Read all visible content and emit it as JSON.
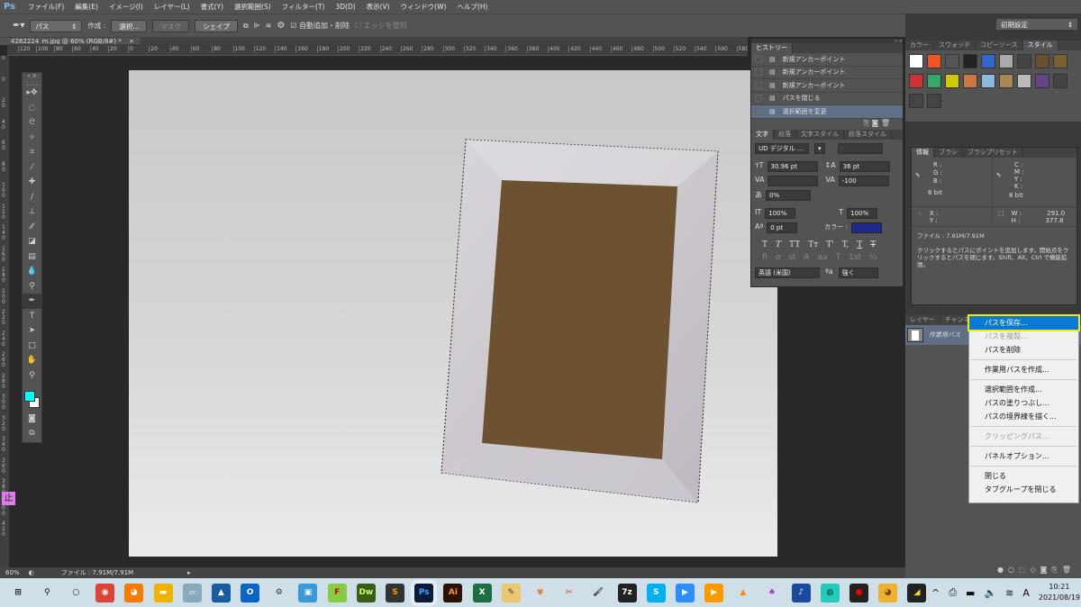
{
  "app": {
    "logo": "Ps",
    "menu": [
      "ファイル(F)",
      "編集(E)",
      "イメージ(I)",
      "レイヤー(L)",
      "書式(Y)",
      "選択範囲(S)",
      "フィルター(T)",
      "3D(D)",
      "表示(V)",
      "ウィンドウ(W)",
      "ヘルプ(H)"
    ]
  },
  "options": {
    "mode": "パス",
    "create_label": "作成 :",
    "select_btn": "選択...",
    "mask_btn": "マスク",
    "shape_btn": "シェイプ",
    "auto_add_label": "自動追加・削除",
    "auto_add_checked": true,
    "align_edges_label": "エッジを整列",
    "align_edges_checked": false,
    "workspace": "初期設定"
  },
  "document": {
    "tab": "4282224_m.jpg @ 60% (RGB/8#) *",
    "close": "×"
  },
  "rulers": {
    "h": [
      "120",
      "100",
      "80",
      "60",
      "40",
      "20",
      "0",
      "20",
      "40",
      "60",
      "80",
      "100",
      "120",
      "140",
      "160",
      "180",
      "200",
      "220",
      "240",
      "260",
      "280",
      "300",
      "320",
      "340",
      "360",
      "380",
      "400",
      "420",
      "440",
      "460",
      "480",
      "500",
      "520",
      "540",
      "560",
      "580",
      "600",
      "620",
      "64"
    ],
    "v": [
      "0",
      "0",
      "2 0",
      "4 0",
      "6 0",
      "8 0",
      "1 0 0",
      "1 2 0",
      "1 4 0",
      "1 6 0",
      "1 8 0",
      "2 0 0",
      "2 2 0",
      "2 4 0",
      "2 6 0",
      "2 8 0",
      "3 0 0",
      "3 2 0",
      "3 4 0",
      "3 6 0",
      "3 8 0",
      "4 0 0",
      "4 2 0"
    ]
  },
  "tools": [
    "move-tool",
    "marquee-tool",
    "lasso-tool",
    "magic-wand-tool",
    "crop-tool",
    "eyedropper-tool",
    "healing-brush-tool",
    "brush-tool",
    "clone-stamp-tool",
    "history-brush-tool",
    "eraser-tool",
    "gradient-tool",
    "blur-tool",
    "dodge-tool",
    "pen-tool",
    "type-tool",
    "path-selection-tool",
    "rectangle-tool",
    "hand-tool",
    "zoom-tool"
  ],
  "colors": {
    "foreground": "#00ffff",
    "background": "#ffffff",
    "text_color": "#1f2a8a",
    "highlight": "#0a78d7",
    "highlight_border": "#f3e80b"
  },
  "stop_badge": "止",
  "history": {
    "tab": "ヒストリー",
    "items": [
      "新規アンカーポイント",
      "新規アンカーポイント",
      "新規アンカーポイント",
      "パスを閉じる",
      "選択範囲を変更"
    ],
    "active": 4
  },
  "character": {
    "tabs": [
      "文字",
      "段落",
      "文字スタイル",
      "段落スタイル"
    ],
    "font": "UD デジタル ...",
    "style": "-",
    "size": "30.96 pt",
    "leading": "36 pt",
    "kerning": "",
    "tracking": "-100",
    "scale_pct": "0%",
    "vscale": "100%",
    "hscale": "100%",
    "baseline": "0 pt",
    "color_label": "カラー :",
    "language": "英語 (米国)",
    "antialias": "強く"
  },
  "styles": {
    "tabs": [
      "カラー",
      "スウォッチ",
      "コピーソース",
      "スタイル"
    ],
    "active": 3
  },
  "info": {
    "tabs": [
      "情報",
      "ブラシ",
      "ブラシプリセット"
    ],
    "rgb": [
      "R :",
      "G :",
      "B :"
    ],
    "cmyk": [
      "C :",
      "M :",
      "Y :",
      "K :"
    ],
    "bits": "8 bit",
    "xy": [
      "X :",
      "Y :"
    ],
    "w_label": "W :",
    "h_label": "H :",
    "w": "291.0",
    "h": "377.8",
    "file": "ファイル : 7.91M/7.91M",
    "hint": "クリックするとパスにポイントを追加します。開始点をクリックするとパスを閉じます。Shift、Alt、Ctrl で機能拡張。"
  },
  "layers": {
    "tabs": [
      "レイヤー",
      "チャンネル"
    ],
    "path_name": "作業用パス"
  },
  "context_menu": {
    "items": [
      {
        "label": "パスを保存...",
        "state": "highlighted"
      },
      {
        "label": "パスを複製...",
        "state": "disabled"
      },
      {
        "label": "パスを削除",
        "state": "normal"
      },
      {
        "sep": true
      },
      {
        "label": "作業用パスを作成...",
        "state": "normal"
      },
      {
        "sep": true
      },
      {
        "label": "選択範囲を作成...",
        "state": "normal"
      },
      {
        "label": "パスの塗りつぶし...",
        "state": "normal"
      },
      {
        "label": "パスの境界線を描く...",
        "state": "normal"
      },
      {
        "sep": true
      },
      {
        "label": "クリッピングパス...",
        "state": "disabled"
      },
      {
        "sep": true
      },
      {
        "label": "パネルオプション...",
        "state": "normal"
      },
      {
        "sep": true
      },
      {
        "label": "閉じる",
        "state": "normal"
      },
      {
        "label": "タブグループを閉じる",
        "state": "normal"
      }
    ]
  },
  "status": {
    "zoom": "60%",
    "file": "ファイル : 7.91M/7.91M"
  },
  "taskbar": {
    "apps": [
      "start",
      "search",
      "cortana",
      "chrome",
      "firefox",
      "file-explorer",
      "notepad",
      "photos",
      "outlook",
      "settings",
      "contacts",
      "ftp",
      "dreamweaver",
      "sublime",
      "photoshop",
      "illustrator",
      "excel",
      "editor",
      "butterfly",
      "snipping",
      "paint",
      "7zip",
      "skype",
      "zoom",
      "video",
      "vlc",
      "app-purple",
      "music",
      "app-teal",
      "recorder",
      "app-bear",
      "sticky"
    ],
    "time": "10:21",
    "date": "2021/08/19",
    "notifications": "2"
  }
}
